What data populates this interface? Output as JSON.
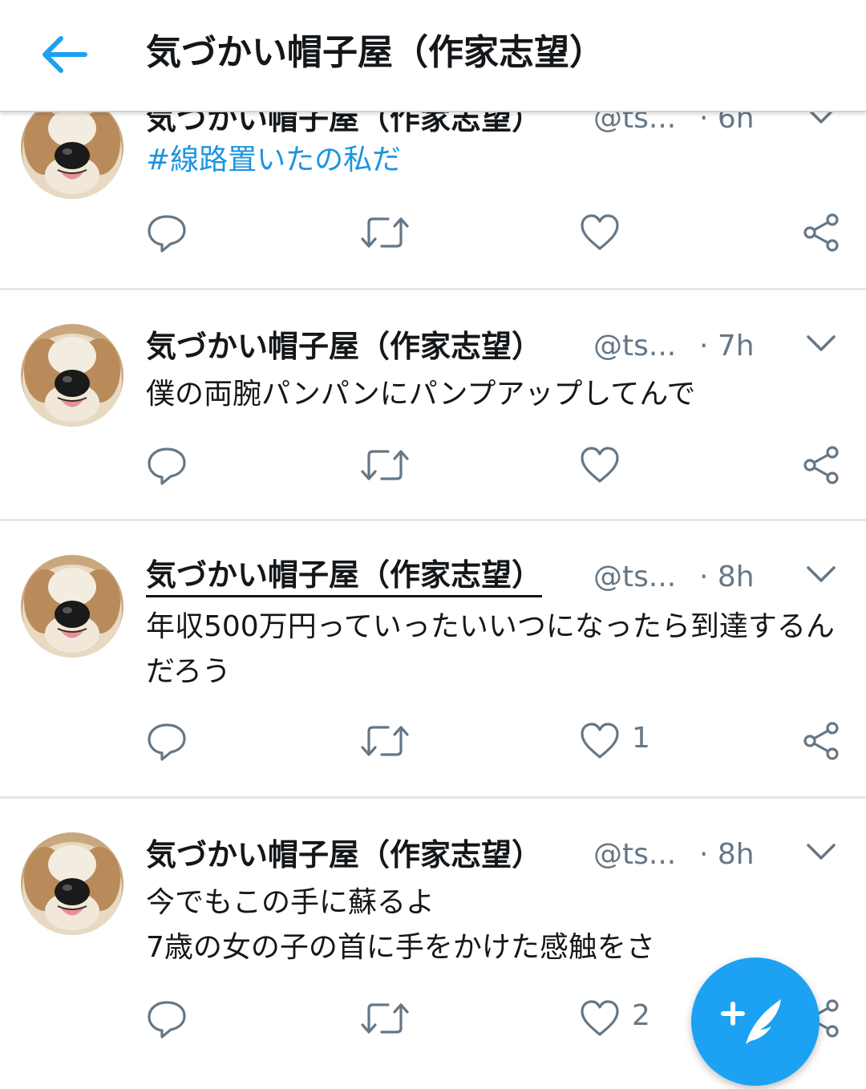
{
  "header": {
    "title": "気づかい帽子屋（作家志望）",
    "back_icon": "arrow-left-icon",
    "accent": "#1da1f2"
  },
  "tweets": [
    {
      "name": "気づかい帽子屋（作家志望）",
      "handle": "@ts...",
      "time": "· 6h",
      "text": "#線路置いたの私だ",
      "likes": ""
    },
    {
      "name": "気づかい帽子屋（作家志望）",
      "handle": "@ts...",
      "time": "· 7h",
      "text": "僕の両腕パンパンにパンプアップしてんで",
      "likes": ""
    },
    {
      "name": "気づかい帽子屋（作家志望）",
      "handle": "@ts...",
      "time": "· 8h",
      "text": "年収500万円っていったいいつになったら到達するんだろう",
      "likes": "1"
    },
    {
      "name": "気づかい帽子屋（作家志望）",
      "handle": "@ts...",
      "time": "· 8h",
      "text": "今でもこの手に蘇るよ\n7歳の女の子の首に手をかけた感触をさ",
      "likes": "2"
    }
  ],
  "action_icons": [
    "reply-icon",
    "retweet-icon",
    "heart-icon",
    "share-icon"
  ],
  "fab": {
    "icon": "compose-tweet-icon",
    "color": "#1da1f2"
  },
  "colors": {
    "text": "#14171a",
    "secondary": "#657786",
    "link": "#1b95e0",
    "divider": "#e1e8ed"
  }
}
